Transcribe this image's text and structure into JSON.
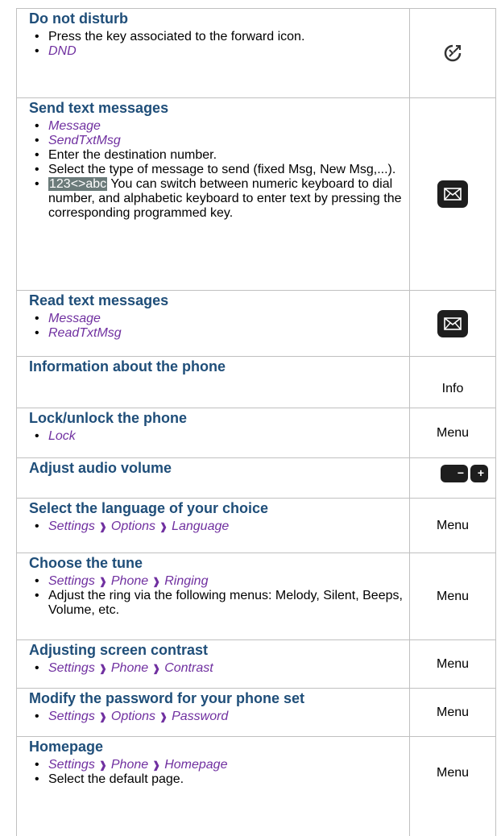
{
  "rows": [
    {
      "title": "Do not disturb",
      "items": [
        {
          "text": "Press the key associated to the forward icon."
        },
        {
          "menu": [
            "DND"
          ]
        }
      ],
      "right_icon": "forward-icon"
    },
    {
      "title": "Send text messages",
      "items": [
        {
          "menu": [
            "Message"
          ]
        },
        {
          "menu": [
            "SendTxtMsg"
          ]
        },
        {
          "text": "Enter the destination number."
        },
        {
          "text": "Select the type of message to send (fixed Msg, New Msg,...)."
        },
        {
          "highlight": "123<>abc",
          "text": " You can switch between numeric keyboard to dial number, and alphabetic keyboard to enter text by pressing the corresponding programmed key."
        }
      ],
      "right_icon": "envelope-key-icon"
    },
    {
      "title": "Read text messages",
      "items": [
        {
          "menu": [
            "Message"
          ]
        },
        {
          "menu": [
            "ReadTxtMsg"
          ]
        }
      ],
      "right_icon": "envelope-key-icon"
    },
    {
      "title": "Information about the phone",
      "items": [],
      "right_text": "Info"
    },
    {
      "title": "Lock/unlock the phone",
      "items": [
        {
          "menu": [
            "Lock"
          ]
        }
      ],
      "right_text": "Menu"
    },
    {
      "title": "Adjust audio volume",
      "items": [],
      "right_icon": "volume-keys-icon",
      "volume_glyphs": [
        "−",
        "+"
      ]
    },
    {
      "title": "Select the language of your choice",
      "items": [
        {
          "menu": [
            "Settings",
            "Options",
            "Language"
          ]
        }
      ],
      "right_text": "Menu"
    },
    {
      "title": "Choose the tune",
      "items": [
        {
          "menu": [
            "Settings",
            "Phone",
            "Ringing"
          ]
        },
        {
          "text": "Adjust the ring via the following menus: Melody, Silent, Beeps, Volume, etc."
        }
      ],
      "right_text": "Menu"
    },
    {
      "title": "Adjusting screen contrast",
      "items": [
        {
          "menu": [
            "Settings",
            "Phone",
            "Contrast"
          ]
        }
      ],
      "right_text": "Menu"
    },
    {
      "title": "Modify the password for your phone set",
      "items": [
        {
          "menu": [
            "Settings",
            "Options",
            "Password"
          ]
        }
      ],
      "right_text": "Menu"
    },
    {
      "title": "Homepage",
      "items": [
        {
          "menu": [
            "Settings",
            "Phone",
            "Homepage"
          ]
        },
        {
          "text": "Select the default page."
        }
      ],
      "right_text": "Menu"
    }
  ],
  "menu_separator": "❱"
}
